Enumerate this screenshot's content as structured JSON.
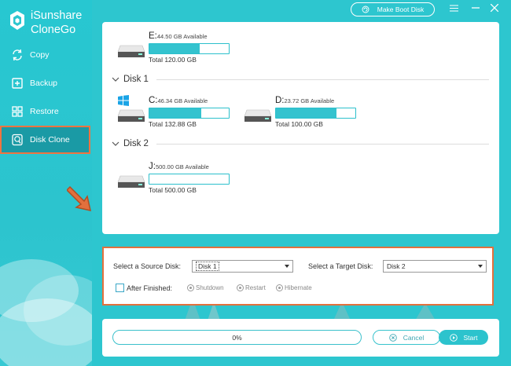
{
  "app": {
    "name_line1": "iSunshare",
    "name_line2": "CloneGo"
  },
  "topbar": {
    "boot_label": "Make Boot Disk",
    "menu_icon": "menu-icon",
    "minimize_icon": "minimize-icon",
    "close_icon": "close-icon"
  },
  "sidebar": {
    "items": [
      {
        "label": "Copy",
        "icon": "copy-icon"
      },
      {
        "label": "Backup",
        "icon": "backup-icon"
      },
      {
        "label": "Restore",
        "icon": "restore-icon"
      },
      {
        "label": "Disk Clone",
        "icon": "disk-clone-icon",
        "active": true
      }
    ]
  },
  "disks": {
    "top_drive": {
      "letter": "E:",
      "available": "44.50 GB Available",
      "total": "Total 120.00 GB",
      "used_fraction": 0.63
    },
    "disk1": {
      "title": "Disk 1",
      "drives": [
        {
          "letter": "C:",
          "available": "46.34 GB Available",
          "total": "Total 132.88 GB",
          "used_fraction": 0.65
        },
        {
          "letter": "D:",
          "available": "23.72 GB Available",
          "total": "Total 100.00 GB",
          "used_fraction": 0.76
        }
      ]
    },
    "disk2": {
      "title": "Disk 2",
      "drives": [
        {
          "letter": "J:",
          "available": "500.00 GB Available",
          "total": "Total 500.00 GB",
          "used_fraction": 0.0
        }
      ]
    }
  },
  "select": {
    "source_label": "Select a Source Disk:",
    "source_value": "Disk 1",
    "target_label": "Select a Target Disk:",
    "target_value": "Disk 2",
    "after_label": "After Finished:",
    "options": [
      "Shutdown",
      "Restart",
      "Hibernate"
    ]
  },
  "progress": {
    "percent_text": "0%",
    "value": 0,
    "cancel_label": "Cancel",
    "start_label": "Start"
  },
  "colors": {
    "accent": "#2dc6cf",
    "highlight": "#e2703d",
    "sidebar_active": "#1a9aa5"
  }
}
